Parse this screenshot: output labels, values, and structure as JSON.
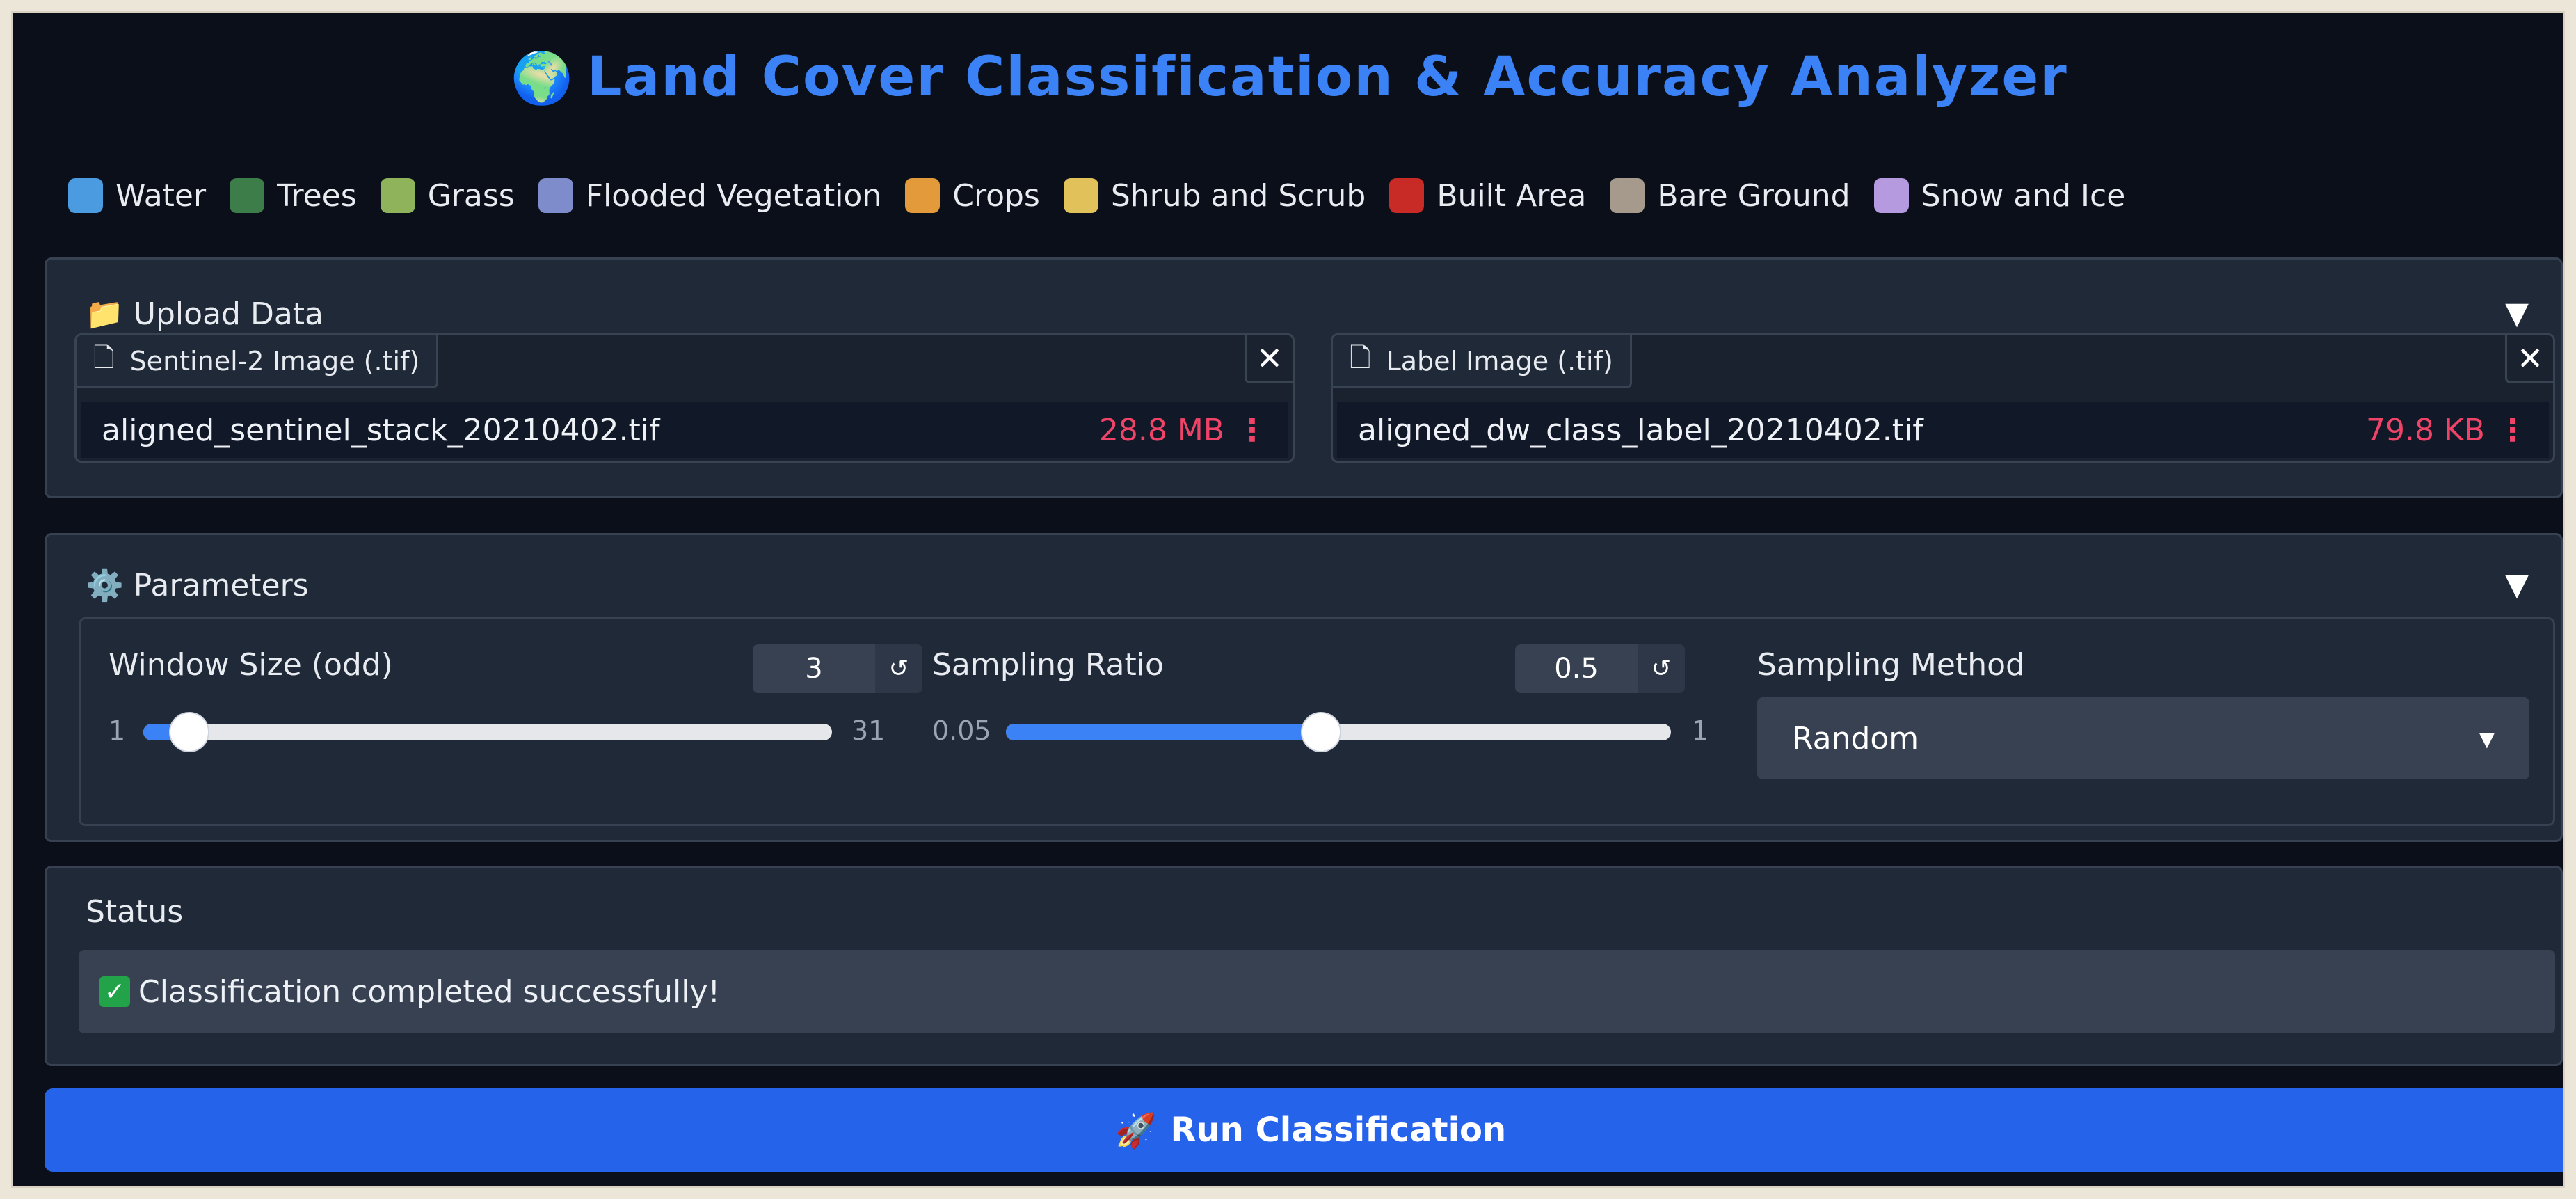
{
  "app": {
    "title": "Land Cover Classification & Accuracy Analyzer",
    "title_icon": "🌍"
  },
  "legend": [
    {
      "label": "Water",
      "color": "#4a9be0"
    },
    {
      "label": "Trees",
      "color": "#3c7d4a"
    },
    {
      "label": "Grass",
      "color": "#8fb35a"
    },
    {
      "label": "Flooded Vegetation",
      "color": "#7e8ccc"
    },
    {
      "label": "Crops",
      "color": "#e39a3b"
    },
    {
      "label": "Shrub and Scrub",
      "color": "#e0c15a"
    },
    {
      "label": "Built Area",
      "color": "#c82a26"
    },
    {
      "label": "Bare Ground",
      "color": "#a69a8d"
    },
    {
      "label": "Snow and Ice",
      "color": "#b59ae0"
    }
  ],
  "upload": {
    "header": "Upload Data",
    "header_icon": "📁",
    "toggle": "▼",
    "files": [
      {
        "tag": "Sentinel-2 Image (.tif)",
        "name": "aligned_sentinel_stack_20210402.tif",
        "size": "28.8 MB"
      },
      {
        "tag": "Label Image (.tif)",
        "name": "aligned_dw_class_label_20210402.tif",
        "size": "79.8 KB"
      }
    ],
    "close_symbol": "✕",
    "more_symbol": "⋮",
    "file_icon": "🗋"
  },
  "parameters": {
    "header": "Parameters",
    "header_icon": "⚙️",
    "toggle": "▼",
    "window_size": {
      "label": "Window Size (odd)",
      "value": "3",
      "min": "1",
      "max": "31",
      "position": 0.067
    },
    "sampling_ratio": {
      "label": "Sampling Ratio",
      "value": "0.5",
      "min": "0.05",
      "max": "1",
      "position": 0.474
    },
    "sampling_method": {
      "label": "Sampling Method",
      "value": "Random",
      "caret": "▾"
    },
    "reset_symbol": "↺"
  },
  "status": {
    "label": "Status",
    "message": "Classification completed successfully!",
    "check": "✓"
  },
  "run_button": {
    "icon": "🚀",
    "label": "Run Classification"
  }
}
